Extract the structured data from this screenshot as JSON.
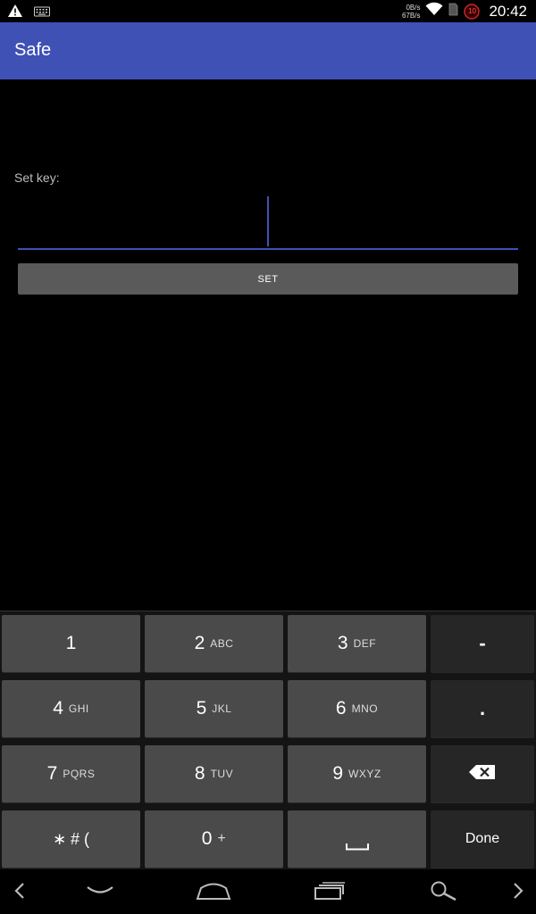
{
  "status_bar": {
    "net_up": "0B/s",
    "net_down": "67B/s",
    "battery_level": "10",
    "time": "20:42"
  },
  "app_bar": {
    "title": "Safe"
  },
  "form": {
    "label": "Set key:",
    "input_value": "",
    "button_label": "SET"
  },
  "keyboard": {
    "rows": [
      [
        {
          "main": "1",
          "sub": ""
        },
        {
          "main": "2",
          "sub": "ABC"
        },
        {
          "main": "3",
          "sub": "DEF"
        },
        {
          "main": "-",
          "sub": ""
        }
      ],
      [
        {
          "main": "4",
          "sub": "GHI"
        },
        {
          "main": "5",
          "sub": "JKL"
        },
        {
          "main": "6",
          "sub": "MNO"
        },
        {
          "main": ".",
          "sub": ""
        }
      ],
      [
        {
          "main": "7",
          "sub": "PQRS"
        },
        {
          "main": "8",
          "sub": "TUV"
        },
        {
          "main": "9",
          "sub": "WXYZ"
        },
        {
          "main": "",
          "sub": ""
        }
      ],
      [
        {
          "main": "∗ # (",
          "sub": ""
        },
        {
          "main": "0",
          "sub": "+"
        },
        {
          "main": "",
          "sub": ""
        },
        {
          "main": "Done",
          "sub": ""
        }
      ]
    ]
  },
  "colors": {
    "primary": "#3f51b5",
    "key": "#4a4a4a",
    "key_dark": "#262626",
    "button": "#5a5a5a"
  },
  "icons": {
    "status_left": [
      "warning-icon",
      "keyboard-icon"
    ],
    "status_right": [
      "wifi-icon",
      "sim-icon",
      "battery-icon"
    ],
    "nav": [
      "back-arrow-icon",
      "hide-keyboard-icon",
      "home-icon",
      "recents-icon",
      "search-icon",
      "forward-arrow-icon"
    ],
    "keyboard": [
      "space-icon",
      "backspace-icon"
    ]
  }
}
